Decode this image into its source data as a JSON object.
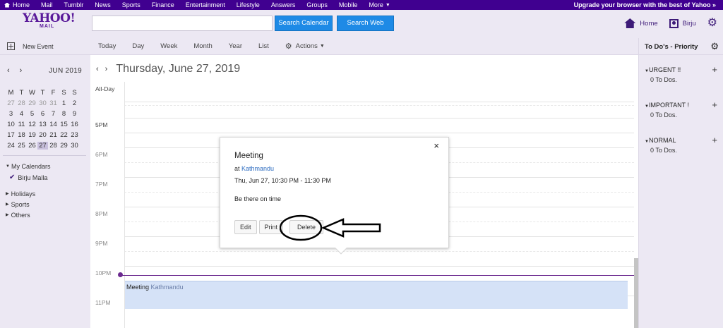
{
  "topnav": {
    "items": [
      "Home",
      "Mail",
      "Tumblr",
      "News",
      "Sports",
      "Finance",
      "Entertainment",
      "Lifestyle",
      "Answers",
      "Groups",
      "Mobile",
      "More"
    ],
    "upgrade": "Upgrade your browser with the best of Yahoo »"
  },
  "header": {
    "logo": "YAHOO!",
    "logo_sub": "MAIL",
    "search_placeholder": "",
    "search_calendar": "Search Calendar",
    "search_web": "Search Web",
    "home": "Home",
    "user": "Birju"
  },
  "toolbar": {
    "new_event": "New Event",
    "views": [
      "Today",
      "Day",
      "Week",
      "Month",
      "Year",
      "List"
    ],
    "actions": "Actions"
  },
  "todo": {
    "title": "To Do's - Priority",
    "sections": [
      {
        "name": "URGENT !!",
        "count": "0 To Dos."
      },
      {
        "name": "IMPORTANT !",
        "count": "0 To Dos."
      },
      {
        "name": "NORMAL",
        "count": "0 To Dos."
      }
    ]
  },
  "mini_calendar": {
    "month": "JUN 2019",
    "weekdays": [
      "M",
      "T",
      "W",
      "T",
      "F",
      "S",
      "S"
    ],
    "weeks": [
      [
        "27",
        "28",
        "29",
        "30",
        "31",
        "1",
        "2"
      ],
      [
        "3",
        "4",
        "5",
        "6",
        "7",
        "8",
        "9"
      ],
      [
        "10",
        "11",
        "12",
        "13",
        "14",
        "15",
        "16"
      ],
      [
        "17",
        "18",
        "19",
        "20",
        "21",
        "22",
        "23"
      ],
      [
        "24",
        "25",
        "26",
        "27",
        "28",
        "29",
        "30"
      ]
    ],
    "today": "27"
  },
  "calendars": {
    "my_calendars": "My Calendars",
    "owner": "Birju Malla",
    "others": [
      "Holidays",
      "Sports",
      "Others"
    ]
  },
  "day_view": {
    "title": "Thursday, June 27, 2019",
    "all_day": "All-Day",
    "hours": [
      "5PM",
      "6PM",
      "7PM",
      "8PM",
      "9PM",
      "10PM",
      "11PM"
    ],
    "event": {
      "title": "Meeting",
      "location": "Kathmandu"
    }
  },
  "popup": {
    "title": "Meeting",
    "at": "at",
    "location": "Kathmandu",
    "time": "Thu, Jun 27, 10:30 PM - 11:30 PM",
    "note": "Be there on time",
    "edit": "Edit",
    "print": "Print",
    "delete": "Delete",
    "close": "×"
  }
}
